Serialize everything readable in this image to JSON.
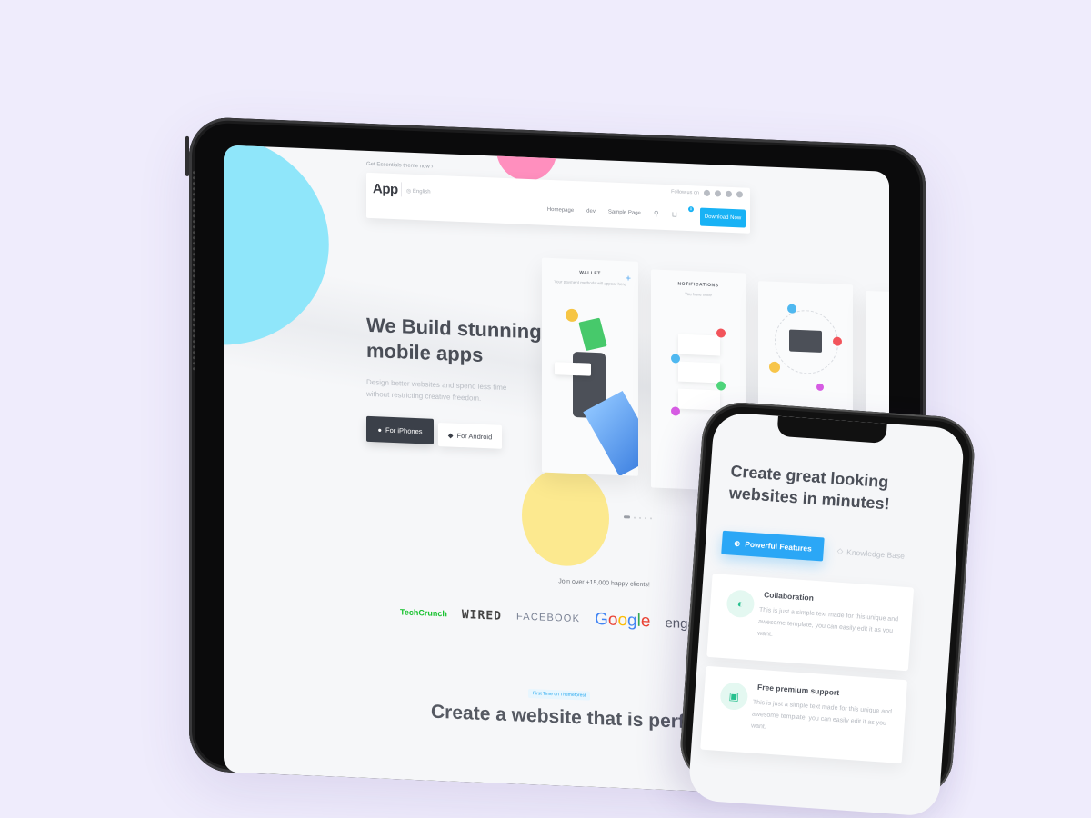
{
  "background_color": "#efecfc",
  "tablet": {
    "topline": "Get Essentials theme now  ›",
    "navbar": {
      "logo": "App",
      "language": "English",
      "follow_label": "Follow us on",
      "social_icons": [
        "facebook-icon",
        "twitter-icon",
        "instagram-icon",
        "dribbble-icon"
      ],
      "links": [
        "Homepage",
        "dev",
        "Sample Page"
      ],
      "cart_count": "0",
      "cta_label": "Download Now",
      "accent_color": "#18b2f5"
    },
    "hero": {
      "title": "We Build stunning mobile apps",
      "subtitle": "Design better websites and spend less time without restricting creative freedom.",
      "ios_button": "For iPhones",
      "android_button": "For Android"
    },
    "app_cards": [
      {
        "title": "WALLET",
        "subtitle": "Your payment methods will appear here"
      },
      {
        "title": "NOTIFICATIONS",
        "subtitle": "You have none"
      },
      {
        "title": "",
        "subtitle": ""
      }
    ],
    "carousel": {
      "active_index": 0,
      "count": 5
    },
    "clients_text": "Join over +15,000 happy clients!",
    "logos": [
      "TechCrunch",
      "WIRED",
      "FACEBOOK",
      "Google",
      "engadget"
    ],
    "badge": "First Time on Themeforest",
    "section_title": "Create a website that is perfect"
  },
  "phone": {
    "title": "Create great looking websites in minutes!",
    "tabs": [
      {
        "label": "Powerful Features",
        "active": true
      },
      {
        "label": "Knowledge Base",
        "active": false
      }
    ],
    "features": [
      {
        "title": "Collaboration",
        "body": "This is just a simple text made for this unique and awesome template, you can easily edit it as you want."
      },
      {
        "title": "Free premium support",
        "body": "This is just a simple text made for this unique and awesome template, you can easily edit it as you want."
      }
    ]
  }
}
